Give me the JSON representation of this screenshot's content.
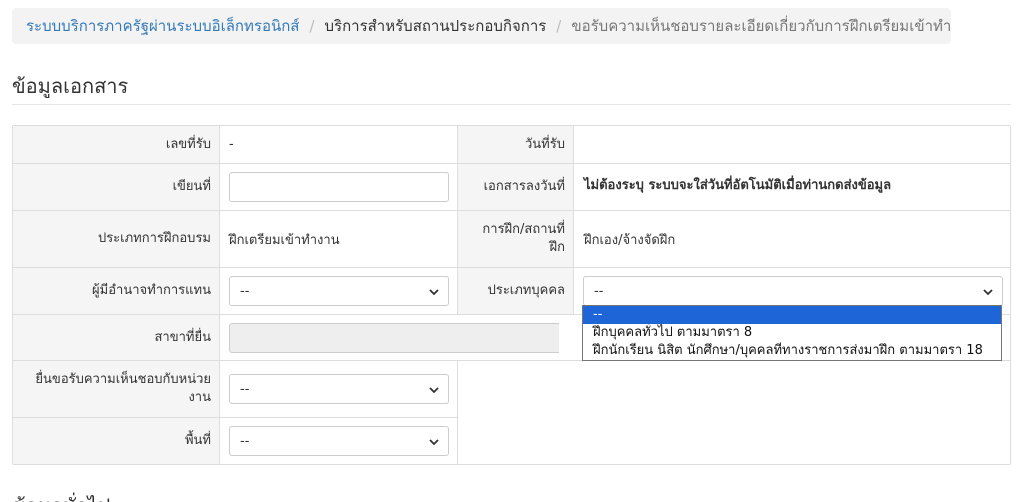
{
  "breadcrumb": {
    "home": "ระบบบริการภาครัฐผ่านระบบอิเล็กทรอนิกส์",
    "section": "บริการสำหรับสถานประกอบกิจการ",
    "current": "ขอรับความเห็นชอบรายละเอียดเกี่ยวกับการฝึกเตรียมเข้าทำงาน"
  },
  "document_section": {
    "title": "ข้อมูลเอกสาร"
  },
  "form": {
    "receive_no_label": "เลขที่รับ",
    "receive_no_value": "-",
    "receive_date_label": "วันที่รับ",
    "receive_date_value": "",
    "written_at_label": "เขียนที่",
    "written_at_value": "",
    "doc_date_label": "เอกสารลงวันที่",
    "doc_date_value": "ไม่ต้องระบุ ระบบจะใส่วันที่อัตโนมัติเมื่อท่านกดส่งข้อมูล",
    "training_type_label": "ประเภทการฝึกอบรม",
    "training_type_value": "ฝึกเตรียมเข้าทำงาน",
    "training_place_label_1": "การฝึก/สถานที่",
    "training_place_label_2": "ฝึก",
    "training_place_value": "ฝึกเอง/จ้างจัดฝึก",
    "authorized_person_label": "ผู้มีอำนาจทำการแทน",
    "authorized_person_value": "--",
    "person_type_label": "ประเภทบุคคล",
    "person_type_value": "--",
    "branch_label": "สาขาที่ยื่น",
    "branch_value": "",
    "submit_unit_label_1": "ยื่นขอรับความเห็นชอบกับหน่วย",
    "submit_unit_label_2": "งาน",
    "submit_unit_value": "--",
    "area_label": "พื้นที่",
    "area_value": "--"
  },
  "person_type_options": [
    "--",
    "ฝึกบุคคลทั่วไป ตามมาตรา 8",
    "ฝึกนักเรียน นิสิต นักศึกษา/บุคคลที่ทางราชการส่งมาฝึก ตามมาตรา 18"
  ],
  "person_type_selected_index": 0,
  "next_section": {
    "title": "ข้อมูลทั่วไป"
  },
  "icons": {
    "select_arrow": "chevron-down-icon"
  }
}
